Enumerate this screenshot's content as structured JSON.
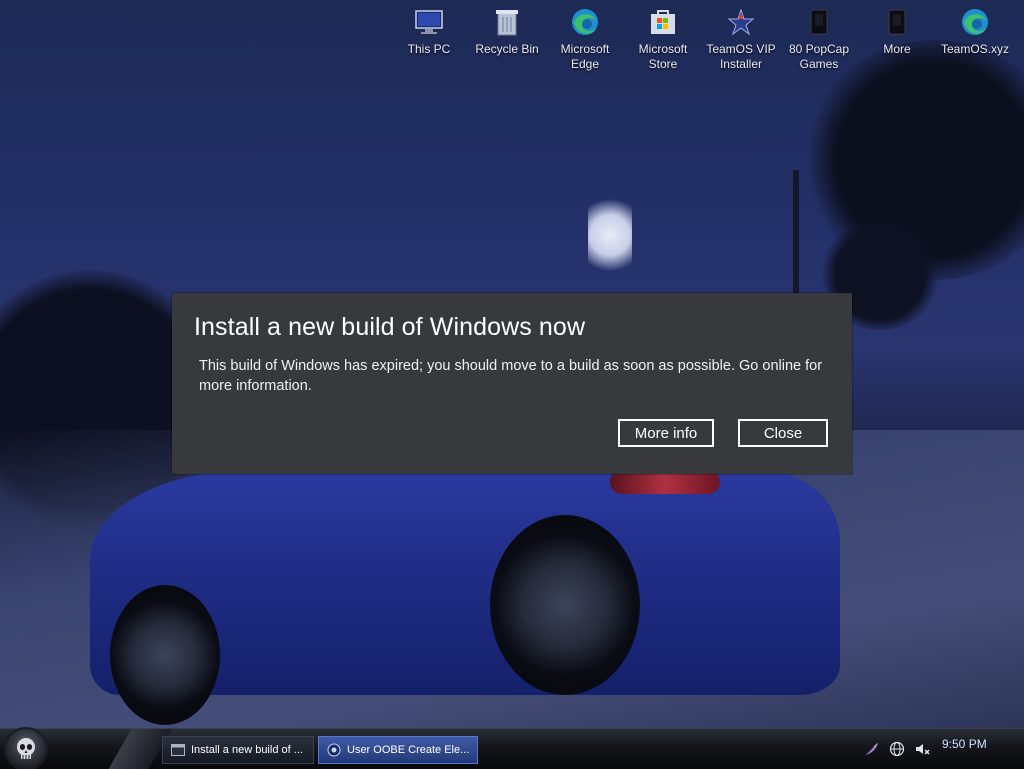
{
  "desktop": {
    "icons": [
      {
        "label": "This PC",
        "icon": "this-pc-icon"
      },
      {
        "label": "Recycle Bin",
        "icon": "recycle-bin-icon"
      },
      {
        "label": "Microsoft\nEdge",
        "icon": "edge-icon"
      },
      {
        "label": "Microsoft\nStore",
        "icon": "store-icon"
      },
      {
        "label": "TeamOS VIP\nInstaller",
        "icon": "installer-icon"
      },
      {
        "label": "80 PopCap\nGames",
        "icon": "popcap-icon"
      },
      {
        "label": "More",
        "icon": "more-icon"
      },
      {
        "label": "TeamOS.xyz",
        "icon": "edge-link-icon"
      }
    ]
  },
  "dialog": {
    "title": "Install a new build of Windows now",
    "body": "This build of Windows has expired; you should move to a build as soon as possible. Go online for more information.",
    "more_info_label": "More info",
    "close_label": "Close"
  },
  "taskbar": {
    "items": [
      {
        "label": "Install a new build of ..."
      },
      {
        "label": "User OOBE Create Ele..."
      }
    ],
    "clock": "9:50 PM",
    "tray_icons": [
      "feather-icon",
      "network-icon",
      "volume-muted-icon"
    ],
    "active_color": "#3f5aa8"
  }
}
